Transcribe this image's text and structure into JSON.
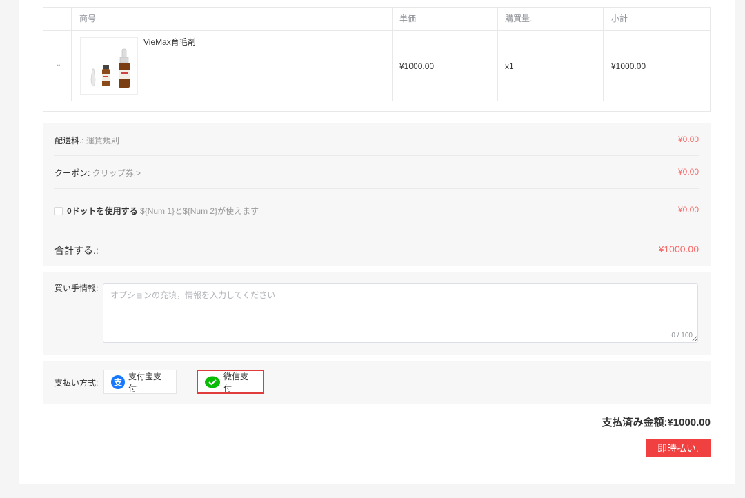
{
  "table": {
    "headers": {
      "product": "商号.",
      "unit_price": "単価",
      "quantity": "購買量.",
      "subtotal": "小計"
    },
    "rows": [
      {
        "name": "VieMax育毛剤",
        "unit_price": "¥1000.00",
        "quantity": "x1",
        "subtotal": "¥1000.00"
      }
    ]
  },
  "summary": {
    "shipping_label": "配送料.",
    "shipping_sub": "運賃規則",
    "shipping_amount": "¥0.00",
    "coupon_label": "クーポン",
    "coupon_sub": "クリップ券.>",
    "coupon_amount": "¥0.00",
    "points_label": "0ドットを使用する",
    "points_sub": "${Num 1}と${Num 2}が使えます",
    "points_amount": "¥0.00",
    "total_label": "合計する.:",
    "total_amount": "¥1000.00"
  },
  "buyer": {
    "label": "買い手情報:",
    "placeholder": "オプションの充填，情報を入力してください",
    "counter": "0 / 100"
  },
  "payment": {
    "label": "支払い方式:",
    "methods": [
      {
        "label": "支付宝支付",
        "icon": "alipay-icon",
        "color": "#1677ff",
        "selected": false
      },
      {
        "label": "微信支付",
        "icon": "wechat-icon",
        "color": "#09bb07",
        "selected": true
      }
    ]
  },
  "paid_amount": "支払済み金額:¥1000.00",
  "pay_now": "即時払い."
}
